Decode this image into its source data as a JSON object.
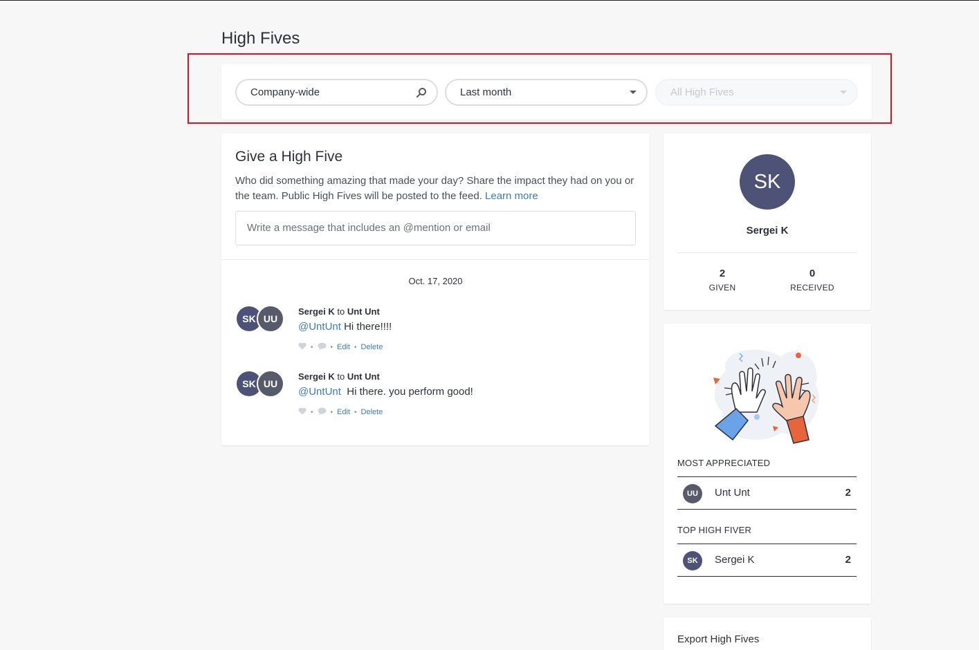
{
  "page": {
    "title": "High Fives"
  },
  "filters": {
    "scope": {
      "value": "Company-wide",
      "icon": "search-icon"
    },
    "period": {
      "value": "Last month",
      "icon": "chevron-down-icon"
    },
    "type": {
      "value": "All High Fives",
      "icon": "chevron-down-icon",
      "disabled": true
    }
  },
  "give": {
    "title": "Give a High Five",
    "description": "Who did something amazing that made your day? Share the impact they had on you or the team. Public High Fives will be posted to the feed.",
    "learn_more": "Learn more",
    "placeholder": "Write a message that includes an @mention or email"
  },
  "feed": {
    "date": "Oct. 17, 2020",
    "posts": [
      {
        "from_initials": "SK",
        "to_initials": "UU",
        "from": "Sergei K",
        "connector": "to",
        "to": "Unt Unt",
        "mention": "@UntUnt",
        "text": " Hi there!!!!",
        "edit": "Edit",
        "delete": "Delete"
      },
      {
        "from_initials": "SK",
        "to_initials": "UU",
        "from": "Sergei K",
        "connector": "to",
        "to": "Unt Unt",
        "mention": "@UntUnt",
        "text": "  Hi there. you perform good!",
        "edit": "Edit",
        "delete": "Delete"
      }
    ]
  },
  "profile": {
    "initials": "SK",
    "name": "Sergei K",
    "given": {
      "value": "2",
      "label": "GIVEN"
    },
    "received": {
      "value": "0",
      "label": "RECEIVED"
    }
  },
  "appreciation": {
    "most_appreciated": {
      "label": "MOST APPRECIATED",
      "initials": "UU",
      "name": "Unt Unt",
      "count": "2"
    },
    "top_high_fiver": {
      "label": "TOP HIGH FIVER",
      "initials": "SK",
      "name": "Sergei K",
      "count": "2"
    }
  },
  "export": {
    "title": "Export High Fives"
  },
  "colors": {
    "accent": "#3b7bb8",
    "avatar_sk": "#4d5276",
    "avatar_uu": "#575a69",
    "highlight": "#e0101f"
  }
}
